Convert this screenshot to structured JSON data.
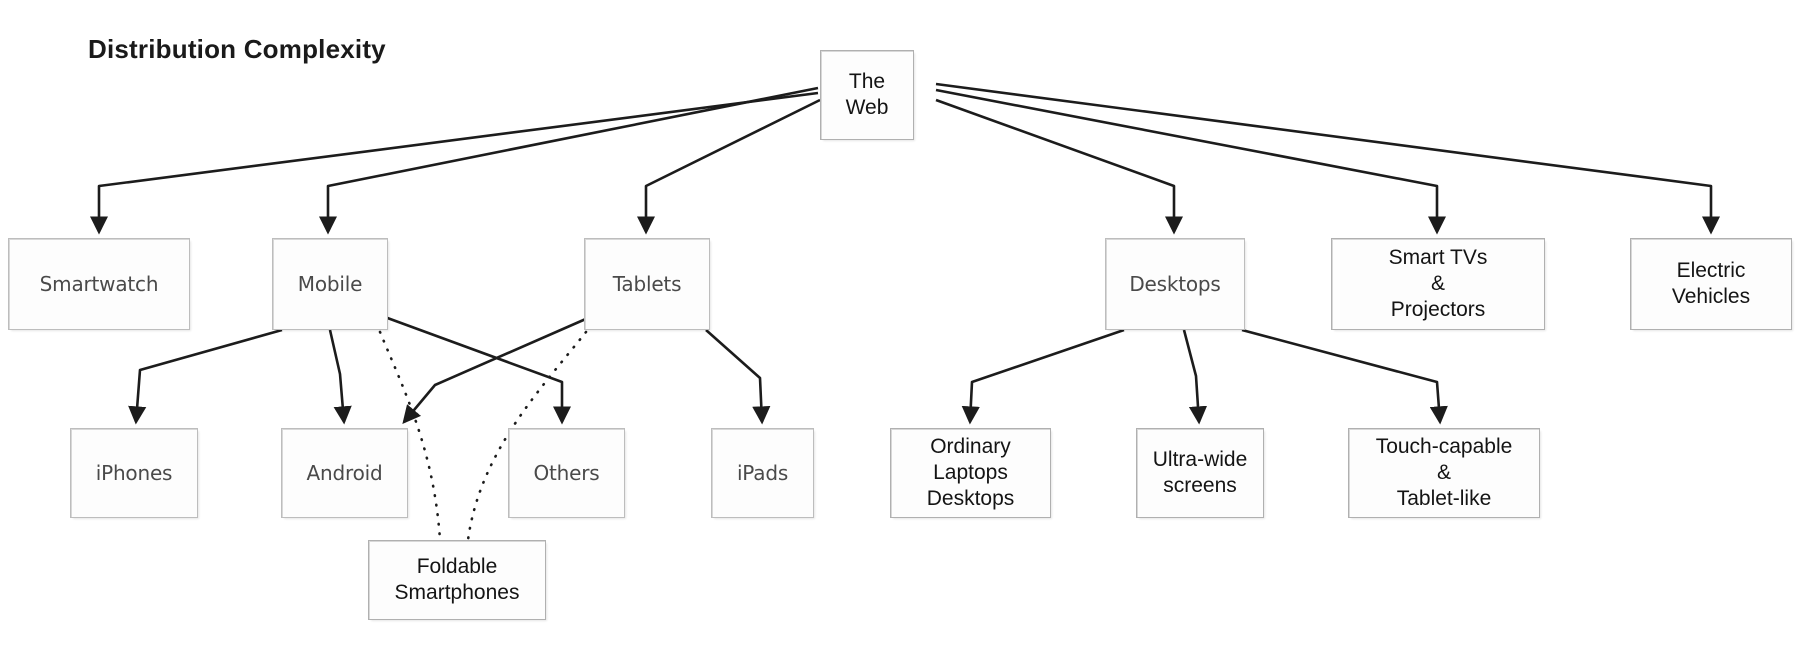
{
  "title": "Distribution Complexity",
  "diagram": {
    "type": "tree-diagram",
    "root": {
      "id": "the-web",
      "label": "The\nWeb"
    },
    "nodes": [
      {
        "id": "smartwatch",
        "label": "Smartwatch",
        "style": "soft"
      },
      {
        "id": "mobile",
        "label": "Mobile",
        "style": "soft"
      },
      {
        "id": "tablets",
        "label": "Tablets",
        "style": "soft"
      },
      {
        "id": "desktops",
        "label": "Desktops",
        "style": "soft"
      },
      {
        "id": "smart-tvs-projectors",
        "label": "Smart TVs\n&\nProjectors",
        "style": "dark"
      },
      {
        "id": "electric-vehicles",
        "label": "Electric\nVehicles",
        "style": "dark"
      },
      {
        "id": "iphones",
        "label": "iPhones",
        "style": "soft"
      },
      {
        "id": "android",
        "label": "Android",
        "style": "soft"
      },
      {
        "id": "others",
        "label": "Others",
        "style": "soft"
      },
      {
        "id": "ipads",
        "label": "iPads",
        "style": "soft"
      },
      {
        "id": "ordinary-laptops-desktops",
        "label": "Ordinary\nLaptops\nDesktops",
        "style": "dark"
      },
      {
        "id": "ultra-wide-screens",
        "label": "Ultra-wide\nscreens",
        "style": "dark"
      },
      {
        "id": "touch-capable-tablet-like",
        "label": "Touch-capable\n&\nTablet-like",
        "style": "dark"
      },
      {
        "id": "foldable-smartphones",
        "label": "Foldable\nSmartphones",
        "style": "dark"
      }
    ],
    "edges": [
      {
        "from": "the-web",
        "to": "smartwatch",
        "style": "solid"
      },
      {
        "from": "the-web",
        "to": "mobile",
        "style": "solid"
      },
      {
        "from": "the-web",
        "to": "tablets",
        "style": "solid"
      },
      {
        "from": "the-web",
        "to": "desktops",
        "style": "solid"
      },
      {
        "from": "the-web",
        "to": "smart-tvs-projectors",
        "style": "solid"
      },
      {
        "from": "the-web",
        "to": "electric-vehicles",
        "style": "solid"
      },
      {
        "from": "mobile",
        "to": "iphones",
        "style": "solid"
      },
      {
        "from": "mobile",
        "to": "android",
        "style": "solid"
      },
      {
        "from": "mobile",
        "to": "others",
        "style": "solid"
      },
      {
        "from": "tablets",
        "to": "android",
        "style": "solid"
      },
      {
        "from": "tablets",
        "to": "ipads",
        "style": "solid"
      },
      {
        "from": "mobile",
        "to": "foldable-smartphones",
        "style": "dotted"
      },
      {
        "from": "tablets",
        "to": "foldable-smartphones",
        "style": "dotted"
      },
      {
        "from": "desktops",
        "to": "ordinary-laptops-desktops",
        "style": "solid"
      },
      {
        "from": "desktops",
        "to": "ultra-wide-screens",
        "style": "solid"
      },
      {
        "from": "desktops",
        "to": "touch-capable-tablet-like",
        "style": "solid"
      }
    ],
    "colors": {
      "edge": "#1c1c1c",
      "node_border": "#b0b0b0",
      "node_fill": "#fdfdfd",
      "title_text": "#1a1a1a",
      "soft_text": "#4a4a4a",
      "dark_text": "#141414"
    }
  }
}
